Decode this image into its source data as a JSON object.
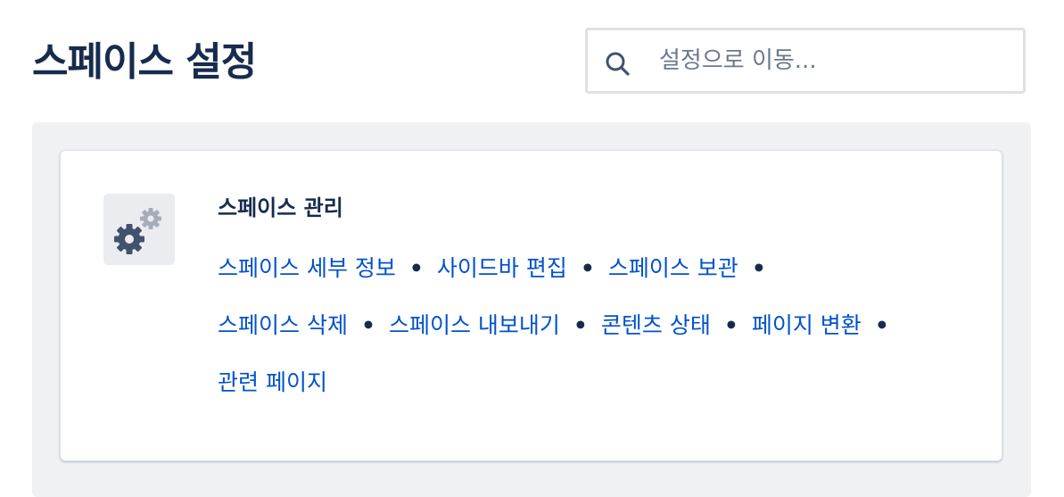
{
  "header": {
    "title": "스페이스 설정"
  },
  "search": {
    "placeholder": "설정으로 이동..."
  },
  "section": {
    "title": "스페이스 관리",
    "icon": "gears-icon",
    "links": [
      {
        "label": "스페이스 세부 정보"
      },
      {
        "label": "사이드바 편집"
      },
      {
        "label": "스페이스 보관"
      },
      {
        "label": "스페이스 삭제"
      },
      {
        "label": "스페이스 내보내기"
      },
      {
        "label": "콘텐츠 상태"
      },
      {
        "label": "페이지 변환"
      },
      {
        "label": "관련 페이지"
      }
    ],
    "separator": "•"
  },
  "colors": {
    "link": "#0052cc",
    "text": "#172b4d",
    "panel_bg": "#f0f1f3",
    "icon_gear_dark": "#42526e",
    "icon_gear_light": "#a5adba"
  }
}
